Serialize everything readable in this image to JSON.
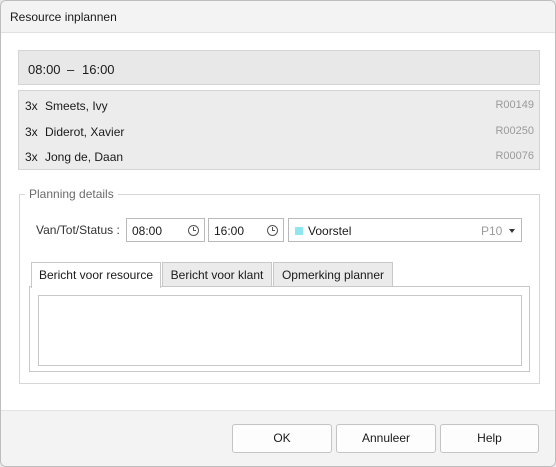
{
  "window": {
    "title": "Resource inplannen"
  },
  "time_range": {
    "start": "08:00",
    "separator": "–",
    "end": "16:00"
  },
  "resources": [
    {
      "qty": "3x",
      "name": "Smeets, Ivy",
      "code": "R00149"
    },
    {
      "qty": "3x",
      "name": "Diderot, Xavier",
      "code": "R00250"
    },
    {
      "qty": "3x",
      "name": "Jong de, Daan",
      "code": "R00076"
    }
  ],
  "planning": {
    "legend": "Planning details",
    "label": "Van/Tot/Status :",
    "from": "08:00",
    "to": "16:00",
    "status": {
      "label": "Voorstel",
      "code": "P10",
      "color": "#8fe6ef"
    },
    "tabs": [
      "Bericht voor resource",
      "Bericht voor klant",
      "Opmerking planner"
    ],
    "active_tab": 0,
    "message": ""
  },
  "buttons": {
    "ok": "OK",
    "cancel": "Annuleer",
    "help": "Help"
  }
}
